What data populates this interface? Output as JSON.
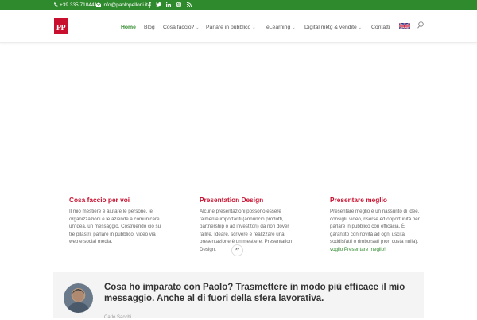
{
  "topbar": {
    "phone": "+39 335 7104412",
    "email": "info@paolopelloni.it",
    "social_icons": [
      "facebook-icon",
      "twitter-icon",
      "linkedin-icon",
      "instagram-icon",
      "rss-icon"
    ],
    "bg_color": "#2e8a2c"
  },
  "header": {
    "logo_text": "PP",
    "nav": [
      {
        "label": "Home",
        "active": true,
        "dropdown": false
      },
      {
        "label": "Blog",
        "active": false,
        "dropdown": false
      },
      {
        "label": "Cosa faccio?",
        "active": false,
        "dropdown": true
      },
      {
        "label": "Parlare in pubblico",
        "active": false,
        "dropdown": true
      },
      {
        "label": "eLearning",
        "active": false,
        "dropdown": true
      },
      {
        "label": "Digital mktg & vendite",
        "active": false,
        "dropdown": true
      },
      {
        "label": "Contatti",
        "active": false,
        "dropdown": false
      }
    ],
    "language_flag": "uk-flag-icon",
    "search_icon": "search-icon"
  },
  "columns": [
    {
      "title": "Cosa faccio per voi",
      "text": "Il mio mestiere è aiutare le persone, le organizzazioni e le aziende a comunicare un'idea, un messaggio. Costruendo ciò su tre pilastri: parlare in pubblico, video via web e social media."
    },
    {
      "title": "Presentation Design",
      "text": "Alcune presentazioni possono essere talmente importanti (annuncio prodotti, partnership o ad investitori) da non dover fallire. Ideare, scrivere e realizzare una presentazione è un mestiere: Presentation Design."
    },
    {
      "title": "Presentare meglio",
      "text": "Presentare meglio è un riassunto di idee, consigli, video, risorse ed opportunità per parlare in pubblico con efficacia. È garantito con novità ad ogni uscita, soddisfatti o rimborsati (non costa nulla).",
      "link": "voglio Presentare meglio!"
    }
  ],
  "testimonial": {
    "quote_icon": "quote-icon",
    "text": "Cosa ho imparato con Paolo? Trasmettere in modo più efficace il mio messaggio. Anche al di fuori della sfera lavorativa.",
    "author": "Carlo Sacchi"
  },
  "colors": {
    "accent_red": "#c8102e",
    "accent_green": "#2e8a2c"
  }
}
